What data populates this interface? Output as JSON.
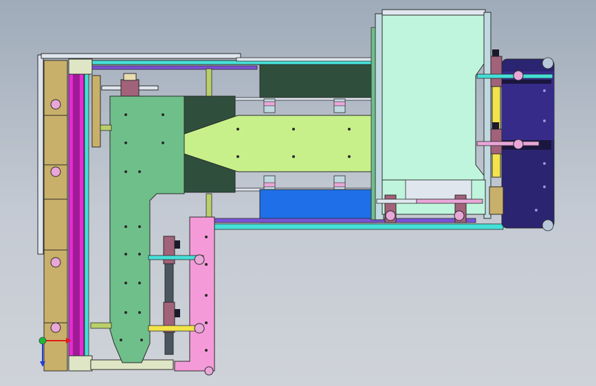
{
  "viewport": {
    "background_top": "#9fabb9",
    "background_bottom": "#cfd3d9"
  },
  "colors": {
    "outline": "#2a2a2a",
    "rail_tan": "#c9b06a",
    "rail_magenta": "#e52bd6",
    "rail_pink": "#f59ad8",
    "mint_plate": "#6fbf8a",
    "dark_green_block": "#2f4f3c",
    "lime_plate": "#c8f08a",
    "blue_block": "#1e6fe8",
    "light_mint_panel": "#bff5dc",
    "navy_plate": "#2b2470",
    "yellow_strip": "#f2e44a",
    "cyan_rail": "#45e0d8",
    "purple_rail": "#7b52d8",
    "pink_clamp": "#e9a6d9",
    "olive_bar": "#b9cf6a",
    "dark_slate": "#4b5560"
  },
  "triad": {
    "x_color": "#e21b1b",
    "y_color": "#1f3fd6",
    "z_color": "#1fb83a"
  }
}
